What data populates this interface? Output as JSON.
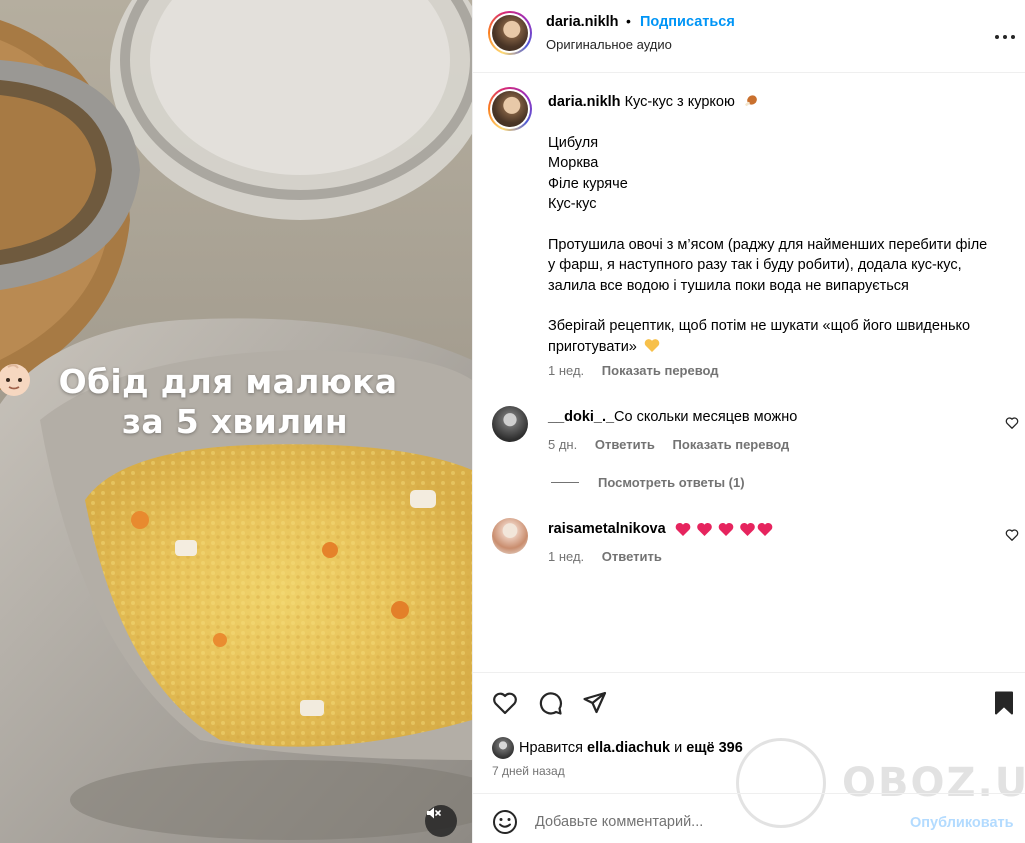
{
  "post": {
    "author": "daria.niklh",
    "follow_label": "Подписаться",
    "separator": "•",
    "audio_label": "Оригинальное аудио",
    "overlay_line1": "Обід для малюка",
    "overlay_line2": "за 5 хвилин",
    "caption_title": "Кус-кус з куркою",
    "caption_lines": [
      "Цибуля",
      "Морква",
      "Філе куряче",
      "Кус-кус"
    ],
    "caption_paragraph1": "Протушила овочі з м’ясом (раджу для найменших перебити філе у фарш, я наступного разу так і буду робити), додала кус-кус, залила все водою і тушила поки вода не випарується",
    "caption_paragraph2": "Зберігай рецептик, щоб потім не шукати «щоб його швиденько приготувати»",
    "caption_time": "1 нед.",
    "translate_label": "Показать перевод"
  },
  "comments": [
    {
      "user": "__doki_._",
      "text": "Со скольки месяцев можно",
      "time": "5 дн.",
      "reply_label": "Ответить",
      "translate_label": "Показать перевод",
      "view_replies": "Посмотреть ответы (1)"
    },
    {
      "user": "raisametalnikova",
      "text": "",
      "time": "1 нед.",
      "reply_label": "Ответить"
    }
  ],
  "likes": {
    "prefix": "Нравится",
    "liker": "ella.diachuk",
    "middle": "и",
    "rest": "ещё 396"
  },
  "post_time": "7 дней назад",
  "comment_box": {
    "placeholder": "Добавьте комментарий...",
    "publish_label": "Опубликовать"
  },
  "watermark": "OBOZ.UA",
  "colors": {
    "accent": "#0095f6",
    "publish_disabled": "#b3dbff",
    "muted_text": "#737373",
    "heart_emoji": "#e6245e"
  },
  "icons": {
    "more": "more-horizontal-icon",
    "like": "heart-icon",
    "comment": "comment-icon",
    "share": "paper-plane-icon",
    "save": "bookmark-icon",
    "emoji": "smiley-icon",
    "mute": "speaker-muted-icon"
  }
}
